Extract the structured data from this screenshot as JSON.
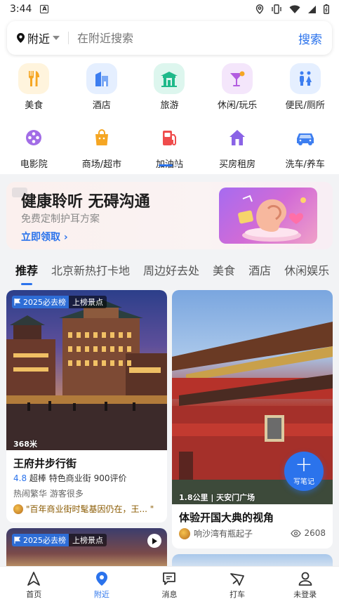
{
  "status_bar": {
    "time": "3:44",
    "notif_badge": "A"
  },
  "search": {
    "location": "附近",
    "placeholder": "在附近搜索",
    "button": "搜索"
  },
  "categories": [
    {
      "label": "美食",
      "icon": "food-icon",
      "color": "#f5a623"
    },
    {
      "label": "酒店",
      "icon": "hotel-icon",
      "color": "#3d7ef0"
    },
    {
      "label": "旅游",
      "icon": "travel-icon",
      "color": "#1fb98a"
    },
    {
      "label": "休闲/玩乐",
      "icon": "cocktail-icon",
      "color": "#b25de0"
    },
    {
      "label": "便民/厕所",
      "icon": "restroom-icon",
      "color": "#3d7ef0"
    },
    {
      "label": "电影院",
      "icon": "film-icon",
      "color": "#a26de6"
    },
    {
      "label": "商场/超市",
      "icon": "shopping-bag-icon",
      "color": "#f5a623"
    },
    {
      "label": "加油站",
      "icon": "fuel-icon",
      "color": "#ef4c4c"
    },
    {
      "label": "买房租房",
      "icon": "house-icon",
      "color": "#8a63e6"
    },
    {
      "label": "洗车/养车",
      "icon": "car-icon",
      "color": "#3d7ef0"
    }
  ],
  "ad": {
    "title": "健康聆听 无碍沟通",
    "subtitle": "免费定制护耳方案",
    "cta": "立即领取"
  },
  "feed_tabs": [
    "推荐",
    "北京新热打卡地",
    "周边好去处",
    "美食",
    "酒店",
    "休闲娱乐"
  ],
  "cards": {
    "left1": {
      "rank_badge": "2025必去榜",
      "rank_type": "上榜景点",
      "distance": "368米",
      "title": "王府井步行街",
      "score": "4.8",
      "score_label": "超棒",
      "category": "特色商业街",
      "reviews": "900评价",
      "tags": "热闹繁华  游客很多",
      "quote": "\"百年商业街时髦基因仍在，王...  \""
    },
    "right1": {
      "distance_place": "1.8公里 | 天安门广场",
      "title": "体验开国大典的视角",
      "user": "响沙湾有瓶起子",
      "views": "2608"
    },
    "left2": {
      "rank_badge": "2025必去榜",
      "rank_type": "上榜景点"
    }
  },
  "fab": {
    "label": "写笔记"
  },
  "bottom_nav": [
    {
      "label": "首页",
      "icon": "home-icon"
    },
    {
      "label": "附近",
      "icon": "nearby-icon"
    },
    {
      "label": "消息",
      "icon": "message-icon"
    },
    {
      "label": "打车",
      "icon": "taxi-icon"
    },
    {
      "label": "未登录",
      "icon": "user-icon"
    }
  ],
  "colors": {
    "accent": "#2b73ec",
    "rank_blue": "#2e6dd6"
  }
}
